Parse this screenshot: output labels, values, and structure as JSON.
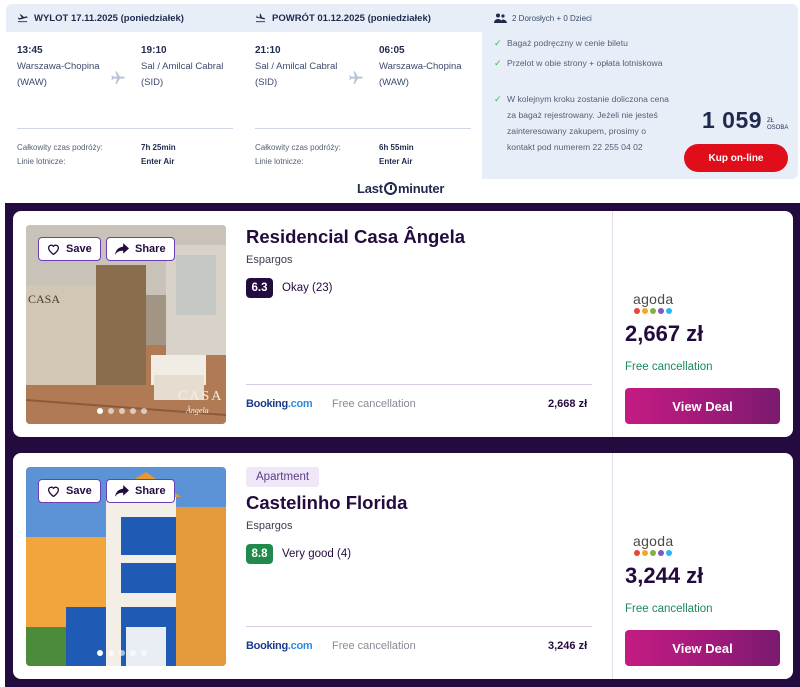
{
  "flight": {
    "outbound": {
      "header": "WYLOT 17.11.2025 (poniedziałek)",
      "dep_time": "13:45",
      "dep_place": "Warszawa-Chopina (WAW)",
      "arr_time": "19:10",
      "arr_place": "Sal / Amilcal Cabral (SID)",
      "duration_label": "Całkowity czas podróży:",
      "duration": "7h 25min",
      "airline_label": "Linie lotnicze:",
      "airline": "Enter Air"
    },
    "return": {
      "header": "POWRÓT 01.12.2025 (poniedziałek)",
      "dep_time": "21:10",
      "dep_place": "Sal / Amilcal Cabral (SID)",
      "arr_time": "06:05",
      "arr_place": "Warszawa-Chopina (WAW)",
      "duration_label": "Całkowity czas podróży:",
      "duration": "6h 55min",
      "airline_label": "Linie lotnicze:",
      "airline": "Enter Air"
    },
    "summary": {
      "passengers": "2 Dorosłych + 0 Dzieci",
      "features": [
        "Bagaż podręczny w cenie biletu",
        "Przelot w obie strony + opłata lotniskowa",
        "W kolejnym kroku zostanie doliczona cena za bagaż rejestrowany. Jeżeli nie jesteś zainteresowany zakupem, prosimy o kontakt pod numerem 22 255 04 02"
      ],
      "price": "1 059",
      "currency": "ZŁ",
      "per": "OSOBA",
      "buy_label": "Kup on-line"
    }
  },
  "logo": {
    "pre": "Last",
    "post": "minuter"
  },
  "hotels": [
    {
      "type": "",
      "name": "Residencial Casa Ângela",
      "city": "Espargos",
      "score": "6.3",
      "score_color": "#240b3f",
      "rating_text": "Okay (23)",
      "save_label": "Save",
      "share_label": "Share",
      "photo_sign": "CASA",
      "photo_sign2": "Ângela",
      "provider1": "Booking",
      "provider1_tld": ".com",
      "free_cancel_1": "Free cancellation",
      "price1": "2,668 zł",
      "provider2": "agoda",
      "price2": "2,667 zł",
      "free_cancel_2": "Free cancellation",
      "deal_label": "View Deal"
    },
    {
      "type": "Apartment",
      "name": "Castelinho Florida",
      "city": "Espargos",
      "score": "8.8",
      "score_color": "#1f8a4c",
      "rating_text": "Very good (4)",
      "save_label": "Save",
      "share_label": "Share",
      "provider1": "Booking",
      "provider1_tld": ".com",
      "free_cancel_1": "Free cancellation",
      "price1": "3,246 zł",
      "provider2": "agoda",
      "price2": "3,244 zł",
      "free_cancel_2": "Free cancellation",
      "deal_label": "View Deal"
    }
  ],
  "colors": {
    "agoda_dots": [
      "#e8443a",
      "#f5a623",
      "#7cb342",
      "#7e57c2",
      "#29b6f6"
    ]
  }
}
